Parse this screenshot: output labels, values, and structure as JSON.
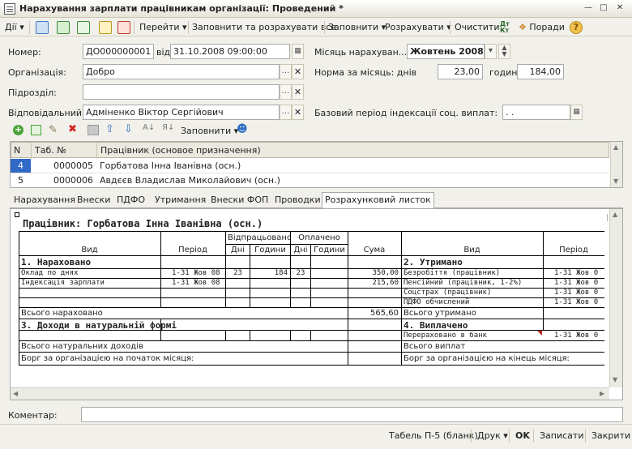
{
  "window": {
    "title": "Нарахування зарплати працівникам організації: Проведений *"
  },
  "toolbar": {
    "actions_label": "Дії",
    "goto_label": "Перейти",
    "fill_calc_label": "Заповнити та розрахувати все",
    "fill_label": "Заповнити",
    "calculate_label": "Розрахувати",
    "clear_label": "Очистити",
    "tips_label": "Поради"
  },
  "form": {
    "number_label": "Номер:",
    "number_value": "ДО000000001",
    "date_label": "від:",
    "date_value": "31.10.2008 09:00:00",
    "month_label": "Місяць нарахуван...",
    "month_value": "Жовтень 2008",
    "org_label": "Організація:",
    "org_value": "Добро",
    "norm_label": "Норма за місяць: днів",
    "norm_days": "23,00",
    "hours_label": "годин",
    "norm_hours": "184,00",
    "division_label": "Підрозділ:",
    "division_value": "",
    "responsible_label": "Відповідальний:",
    "responsible_value": "Адміненко Віктор Сергійович",
    "base_period_label": "Базовий період індексації соц. виплат:",
    "base_period_value": ". ."
  },
  "table_toolbar": {
    "fill_label": "Заповнити"
  },
  "employees": {
    "headers": [
      "N",
      "Таб. №",
      "Працівник (основое призначення)"
    ],
    "rows": [
      {
        "n": "4",
        "tab": "0000005",
        "name": "Горбатова Інна Іванівна (осн.)"
      },
      {
        "n": "5",
        "tab": "0000006",
        "name": "Авдєєв Владислав Миколайович (осн.)"
      }
    ]
  },
  "tabs": [
    "Нарахування",
    "Внески",
    "ПДФО",
    "Утримання",
    "Внески ФОП",
    "Проводки",
    "Розрахунковий листок"
  ],
  "sheet": {
    "employee_title": "Працівник: Горбатова Інна Іванівна (осн.)",
    "h_vyd": "Вид",
    "h_period": "Період",
    "h_worked": "Відпрацьовано",
    "h_paid": "Оплачено",
    "h_days": "Дні",
    "h_hours": "Години",
    "h_sum": "Сума",
    "sec1": "1. Нараховано",
    "sec2": "2. Утримано",
    "sec3": "3. Доходи в натуральній формі",
    "sec4": "4. Виплачено",
    "acc": [
      {
        "name": "Оклад по днях",
        "period": "1-31 Жов 08",
        "wd": "23",
        "wh": "184",
        "pd": "23",
        "ph": "",
        "sum": "350,00"
      },
      {
        "name": "Індексація зарплати",
        "period": "1-31 Жов 08",
        "wd": "",
        "wh": "",
        "pd": "",
        "ph": "",
        "sum": "215,60"
      }
    ],
    "ded": [
      {
        "name": "Безробіття (працівник)",
        "period": "1-31 Жов 0"
      },
      {
        "name": "Пенсійний (працівник, 1-2%)",
        "period": "1-31 Жов 0"
      },
      {
        "name": "Соцстрах (працівник)",
        "period": "1-31 Жов 0"
      },
      {
        "name": "ПДФО обчислений",
        "period": "1-31 Жов 0"
      }
    ],
    "total_acc_label": "Всього нараховано",
    "total_acc_value": "565,60",
    "total_ded_label": "Всього утримано",
    "paid_row": {
      "name": "Перераховано в банк",
      "period": "1-31 Жов 0"
    },
    "total_natural_label": "Всього натуральних доходів",
    "total_paid_label": "Всього виплат",
    "debt_start_label": "Борг за організацією на початок місяця:",
    "debt_end_label": "Борг за організацією на кінець місяця:"
  },
  "comment": {
    "label": "Коментар:",
    "value": ""
  },
  "bottom": {
    "tabel_label": "Табель П-5 (бланк)",
    "print_label": "Друк",
    "ok_label": "OK",
    "save_label": "Записати",
    "close_label": "Закрити"
  },
  "colors": {
    "accent": "#316ac5",
    "selected_row": "#3169c6"
  }
}
